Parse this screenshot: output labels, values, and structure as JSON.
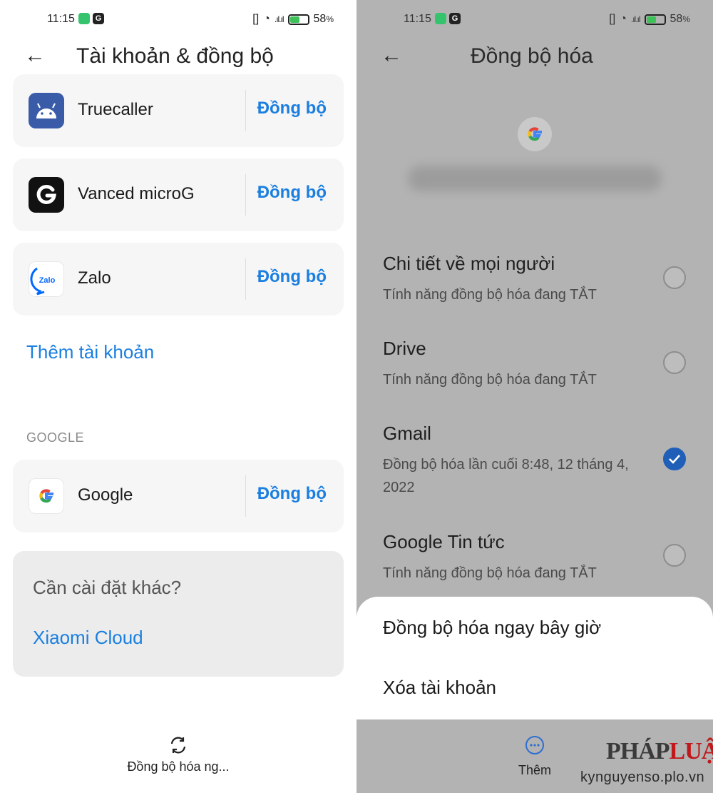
{
  "status": {
    "time": "11:15",
    "badge": "G",
    "battery": "58",
    "battery_unit": "%",
    "battery_level": 0.58
  },
  "left": {
    "title": "Tài khoản & đồng bộ",
    "accounts": [
      {
        "name": "Truecaller",
        "sync_label": "Đồng bộ"
      },
      {
        "name": "Vanced microG",
        "sync_label": "Đồng bộ"
      },
      {
        "name": "Zalo",
        "sync_label": "Đồng bộ"
      }
    ],
    "zalo_icon_text": "Zalo",
    "add_account": "Thêm tài khoản",
    "section_google": "GOOGLE",
    "google_account": {
      "name": "Google",
      "sync_label": "Đồng bộ"
    },
    "other_question": "Cần cài đặt khác?",
    "other_link": "Xiaomi Cloud",
    "bottom_sync": "Đồng bộ hóa ng..."
  },
  "right": {
    "title": "Đồng bộ hóa",
    "sync_items": [
      {
        "title": "Chi tiết về mọi người",
        "subtitle": "Tính năng đồng bộ hóa đang TẮT",
        "checked": false
      },
      {
        "title": "Drive",
        "subtitle": "Tính năng đồng bộ hóa đang TẮT",
        "checked": false
      },
      {
        "title": "Gmail",
        "subtitle": "Đồng bộ hóa lần cuối 8:48, 12 tháng 4, 2022",
        "checked": true
      },
      {
        "title": "Google Tin tức",
        "subtitle": "Tính năng đồng bộ hóa đang TẮT",
        "checked": false
      }
    ],
    "sheet_options": [
      "Đồng bộ hóa ngay bây giờ",
      "Xóa tài khoản"
    ],
    "more_label": "Thêm"
  },
  "watermark": {
    "logo_left": "PHÁP",
    "logo_right": "LUẬT",
    "url": "kynguyenso.plo.vn"
  },
  "colors": {
    "accent": "#1a7fe0",
    "checked": "#1f5fb8",
    "overlay_gray": "#b3b3b3",
    "battery_green": "#3fc15a"
  },
  "icons": [
    "arrow-left-icon",
    "android-icon",
    "g-letter-icon",
    "zalo-icon",
    "google-g-icon",
    "sync-icon",
    "more-icon",
    "check-icon"
  ]
}
